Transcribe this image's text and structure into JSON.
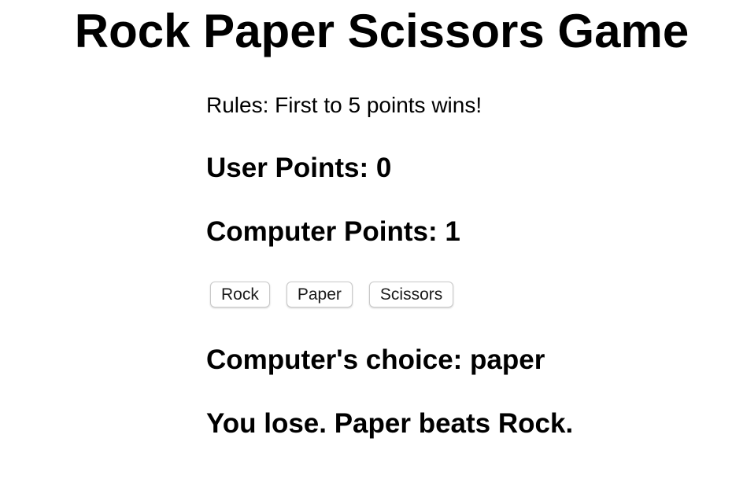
{
  "title": "Rock Paper Scissors Game",
  "rules": "Rules: First to 5 points wins!",
  "scores": {
    "user_label": "User Points: 0",
    "user_points": 0,
    "computer_label": "Computer Points: 1",
    "computer_points": 1
  },
  "buttons": {
    "rock": "Rock",
    "paper": "Paper",
    "scissors": "Scissors"
  },
  "result": {
    "computer_choice": "Computer's choice: paper",
    "message": "You lose. Paper beats Rock."
  }
}
